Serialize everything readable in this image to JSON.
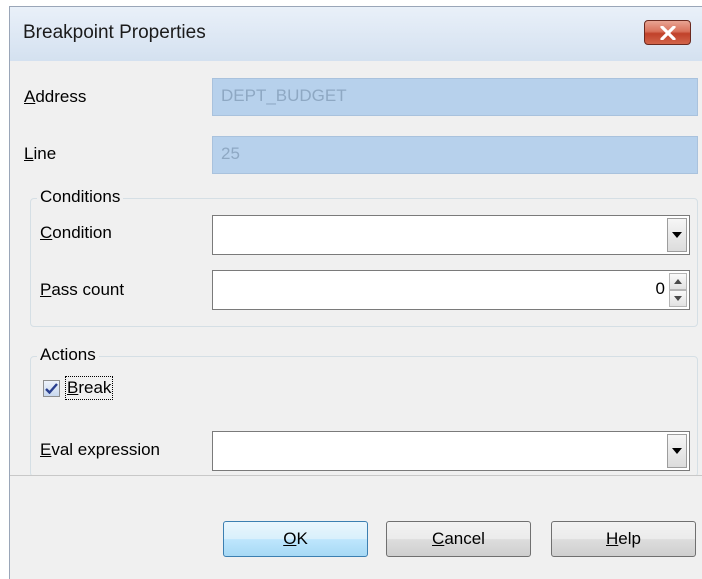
{
  "window": {
    "title": "Breakpoint Properties"
  },
  "general": {
    "address_label_mn": "A",
    "address_label_rest": "ddress",
    "address_value": "DEPT_BUDGET",
    "line_label_mn": "L",
    "line_label_rest": "ine",
    "line_value": "25"
  },
  "conditions": {
    "caption": "Conditions",
    "condition_label_mn": "C",
    "condition_label_rest": "ondition",
    "condition_value": "",
    "pass_count_label_mn": "P",
    "pass_count_label_rest": "ass count",
    "pass_count_value": "0"
  },
  "actions": {
    "caption": "Actions",
    "break_label_mn": "B",
    "break_label_rest": "reak",
    "break_checked": true,
    "eval_label_mn": "E",
    "eval_label_rest": "val expression",
    "eval_value": ""
  },
  "buttons": {
    "ok_mn": "O",
    "ok_rest": "K",
    "cancel_mn": "C",
    "cancel_rest": "ancel",
    "help_mn": "H",
    "help_rest": "elp"
  },
  "icons": {
    "close": "close-icon",
    "dropdown": "chevron-down-icon",
    "spin_up": "spin-up-icon",
    "spin_down": "spin-down-icon",
    "check": "checkmark-icon"
  },
  "colors": {
    "readonly_field_bg": "#b7d1ec",
    "readonly_field_text": "#8ea8c3",
    "close_button": "#c0412a",
    "default_button": "#bee6fd",
    "dialog_background": "#f0f0f0"
  }
}
